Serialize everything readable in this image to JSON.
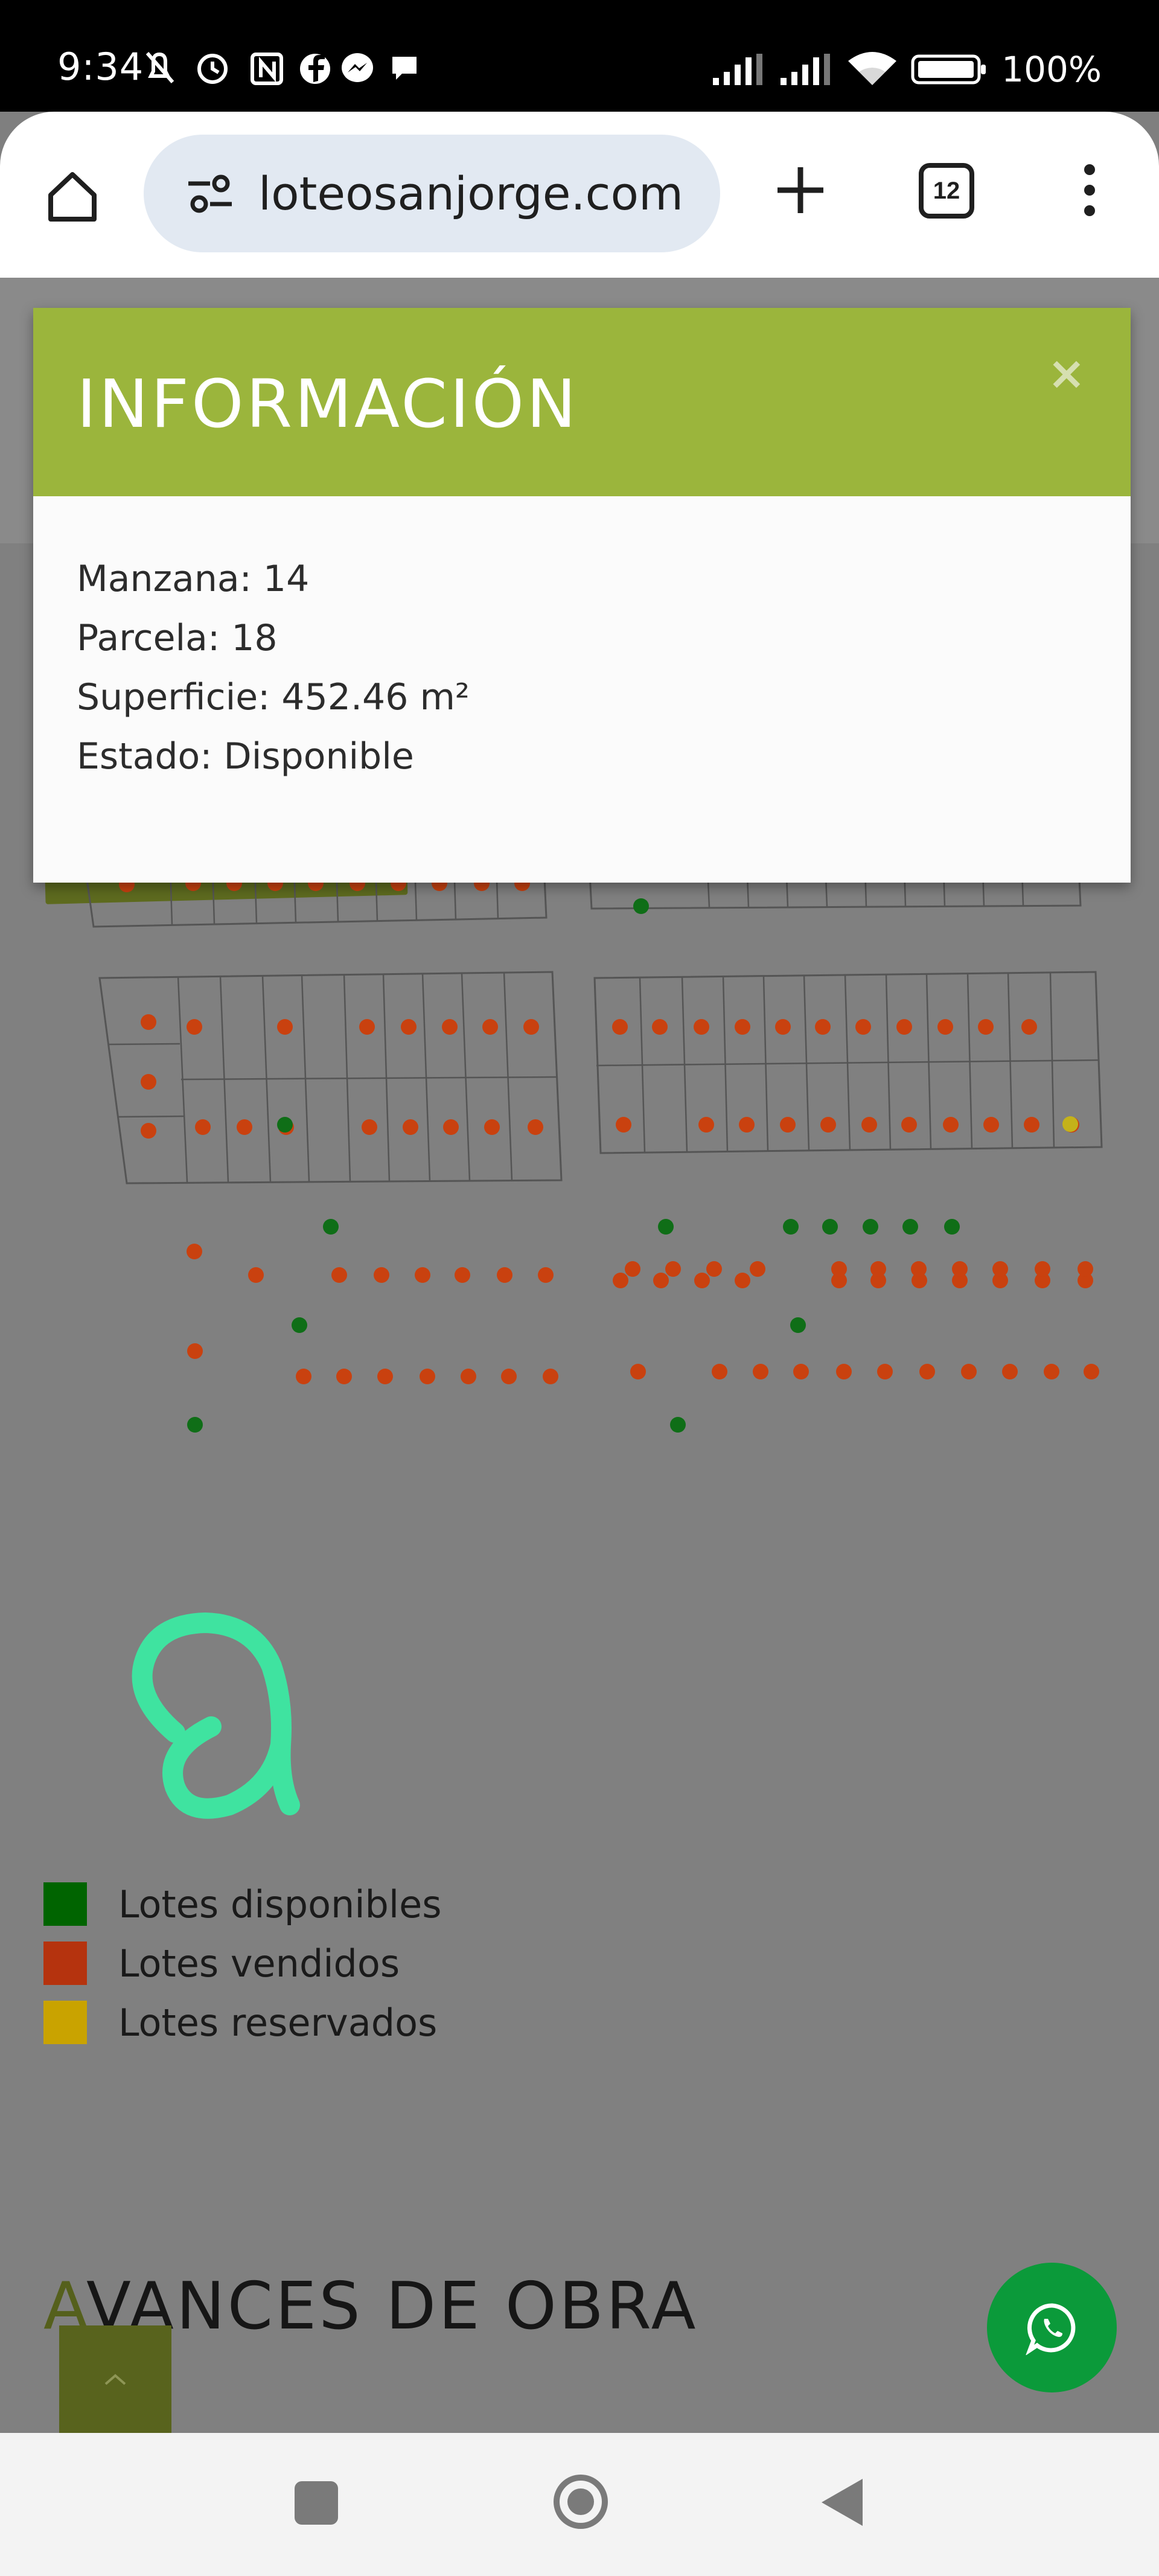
{
  "status_bar": {
    "time": "9:34",
    "notifications": "∂ ⏰ Ⓝ Ⓕ Ⓜ ● ··",
    "battery": "100%"
  },
  "browser": {
    "url": "loteosanjorge.com",
    "tab_count": "12"
  },
  "modal": {
    "title": "INFORMACIÓN",
    "close_label": "×",
    "lines": [
      "Manzana: 14",
      "Parcela: 18",
      "Superficie: 452.46 m²",
      "Estado: Disponible"
    ]
  },
  "legend": {
    "items": [
      {
        "label": "Lotes disponibles",
        "color": "#006400"
      },
      {
        "label": "Lotes vendidos",
        "color": "#b5330e"
      },
      {
        "label": "Lotes reservados",
        "color": "#c9a300"
      }
    ]
  },
  "section": {
    "title_first": "A",
    "title_rest": "VANCES DE OBRA"
  },
  "colors": {
    "available": "#0f6e17",
    "sold": "#c9410f",
    "reserved": "#c4b21a",
    "modal_header": "#9bb53c",
    "annotation": "#3fe3a0",
    "whatsapp": "#0b9a3a"
  },
  "icons": {
    "home": "home-icon",
    "site_info": "tune-icon",
    "new_tab": "plus-icon",
    "menu": "more-vert-icon",
    "whatsapp": "whatsapp-icon",
    "scroll_top": "chevron-up-icon"
  }
}
